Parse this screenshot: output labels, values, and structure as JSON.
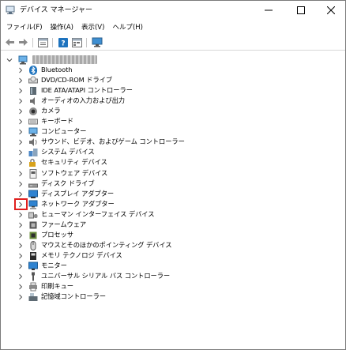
{
  "window": {
    "title": "デバイス マネージャー"
  },
  "menu": [
    "ファイル(F)",
    "操作(A)",
    "表示(V)",
    "ヘルプ(H)"
  ],
  "toolbar": [
    "back",
    "forward",
    "properties",
    "help",
    "show-hidden",
    "monitor"
  ],
  "tree": {
    "categories": [
      {
        "label": "Bluetooth",
        "icon": "bluetooth-icon"
      },
      {
        "label": "DVD/CD-ROM ドライブ",
        "icon": "dvd-drive-icon"
      },
      {
        "label": "IDE ATA/ATAPI コントローラー",
        "icon": "ide-controller-icon"
      },
      {
        "label": "オーディオの入力および出力",
        "icon": "audio-icon"
      },
      {
        "label": "カメラ",
        "icon": "camera-icon"
      },
      {
        "label": "キーボード",
        "icon": "keyboard-icon"
      },
      {
        "label": "コンピューター",
        "icon": "computer-icon"
      },
      {
        "label": "サウンド、ビデオ、およびゲーム コントローラー",
        "icon": "sound-icon"
      },
      {
        "label": "システム デバイス",
        "icon": "system-device-icon"
      },
      {
        "label": "セキュリティ デバイス",
        "icon": "security-device-icon"
      },
      {
        "label": "ソフトウェア デバイス",
        "icon": "software-device-icon"
      },
      {
        "label": "ディスク ドライブ",
        "icon": "disk-drive-icon"
      },
      {
        "label": "ディスプレイ アダプター",
        "icon": "display-adapter-icon"
      },
      {
        "label": "ネットワーク アダプター",
        "icon": "network-adapter-icon"
      },
      {
        "label": "ヒューマン インターフェイス デバイス",
        "icon": "hid-icon"
      },
      {
        "label": "ファームウェア",
        "icon": "firmware-icon"
      },
      {
        "label": "プロセッサ",
        "icon": "processor-icon"
      },
      {
        "label": "マウスとそのほかのポインティング デバイス",
        "icon": "mouse-icon"
      },
      {
        "label": "メモリ テクノロジ デバイス",
        "icon": "memory-device-icon"
      },
      {
        "label": "モニター",
        "icon": "monitor-icon"
      },
      {
        "label": "ユニバーサル シリアル バス コントローラー",
        "icon": "usb-icon"
      },
      {
        "label": "印刷キュー",
        "icon": "print-queue-icon"
      },
      {
        "label": "記憶域コントローラー",
        "icon": "storage-controller-icon"
      }
    ],
    "highlighted_index": 13
  },
  "colors": {
    "highlight": "#e0201f",
    "accent": "#1e73be"
  }
}
